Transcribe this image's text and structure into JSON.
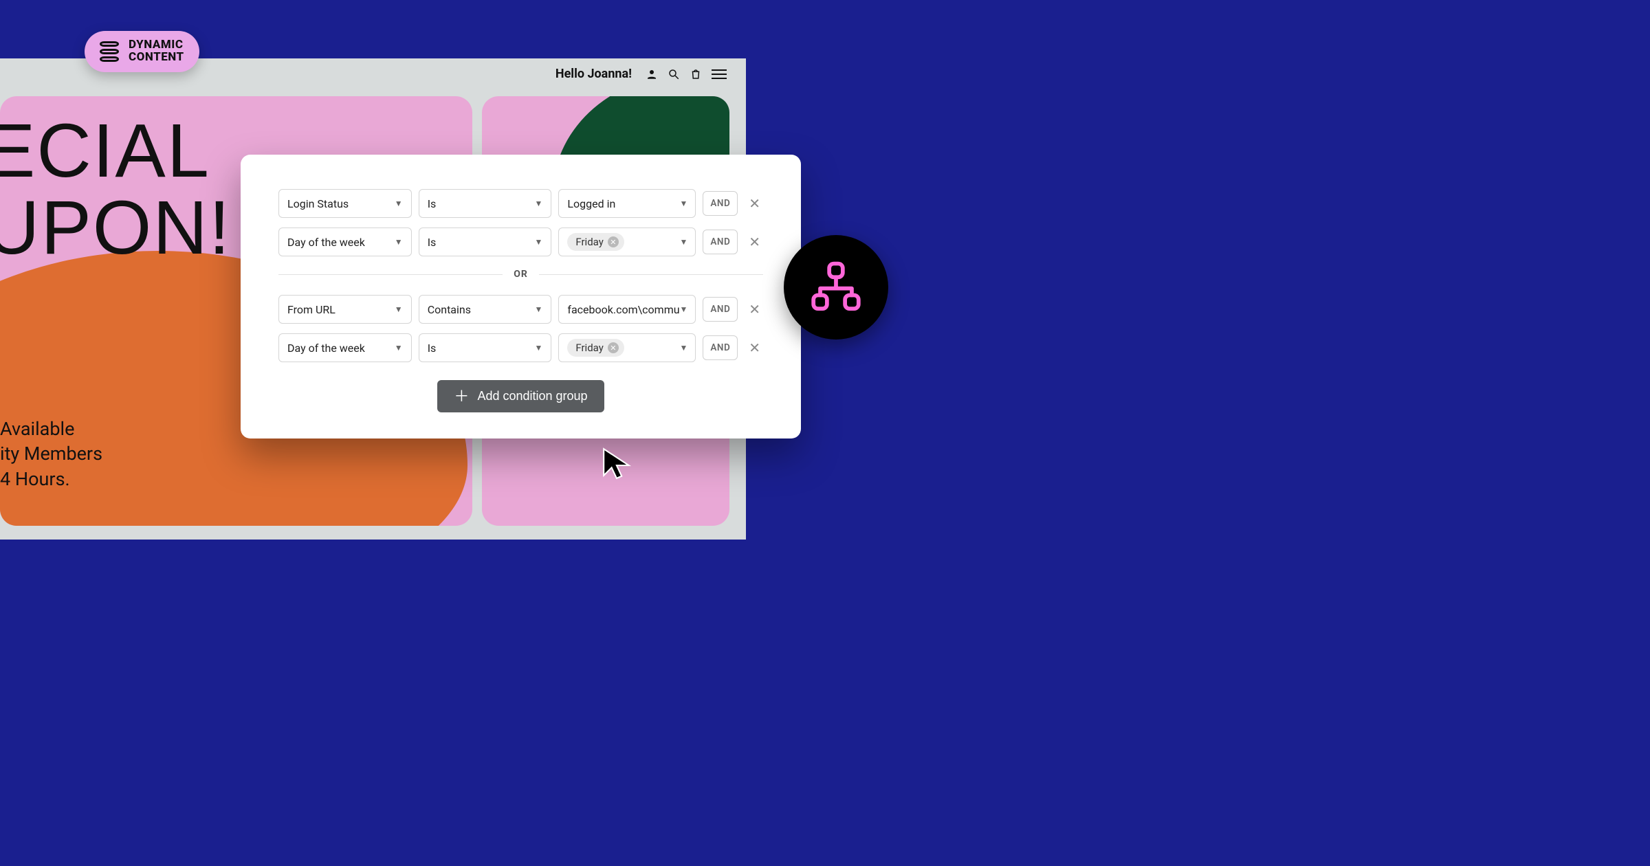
{
  "badge": {
    "title": "DYNAMIC CONTENT"
  },
  "site": {
    "greeting": "Hello Joanna!",
    "hero_title_line1": "ECIAL",
    "hero_title_line2": "UPON!",
    "sub_line1": "Available",
    "sub_line2": "ity Members",
    "sub_line3": "4 Hours."
  },
  "conditions": {
    "group1": {
      "row1": {
        "field": "Login Status",
        "op": "Is",
        "value": "Logged in",
        "chain": "AND"
      },
      "row2": {
        "field": "Day of the week",
        "op": "Is",
        "chip": "Friday",
        "chain": "AND"
      }
    },
    "separator": "OR",
    "group2": {
      "row1": {
        "field": "From URL",
        "op": "Contains",
        "value": "facebook.com\\commu",
        "chain": "AND"
      },
      "row2": {
        "field": "Day of the week",
        "op": "Is",
        "chip": "Friday",
        "chain": "AND"
      }
    },
    "add_group_label": "Add condition group"
  }
}
